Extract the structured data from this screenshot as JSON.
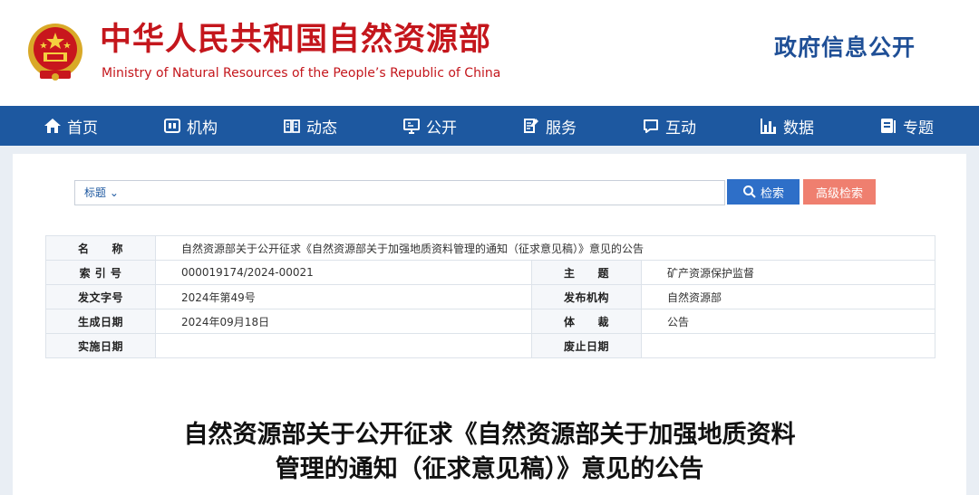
{
  "header": {
    "title": "中华人民共和国自然资源部",
    "subtitle": "Ministry of Natural Resources of the People’s Republic of China",
    "gov_info": "政府信息公开",
    "emblem_icon": "national-emblem-icon"
  },
  "nav": {
    "items": [
      {
        "label": "首页",
        "icon": "home-icon"
      },
      {
        "label": "机构",
        "icon": "org-icon"
      },
      {
        "label": "动态",
        "icon": "news-icon"
      },
      {
        "label": "公开",
        "icon": "monitor-icon"
      },
      {
        "label": "服务",
        "icon": "service-icon"
      },
      {
        "label": "互动",
        "icon": "chat-icon"
      },
      {
        "label": "数据",
        "icon": "bar-chart-icon"
      },
      {
        "label": "专题",
        "icon": "topic-icon"
      }
    ]
  },
  "search": {
    "field": "标题 ⌄",
    "value": "",
    "search_label": "检索",
    "advanced_label": "高级检索"
  },
  "meta": {
    "name_label": "名　　称",
    "name_value": "自然资源部关于公开征求《自然资源部关于加强地质资料管理的通知（征求意见稿）》意见的公告",
    "index_label": "索 引 号",
    "index_value": "000019174/2024-00021",
    "topic_label": "主　　题",
    "topic_value": "矿产资源保护监督",
    "docno_label": "发文字号",
    "docno_value": "2024年第49号",
    "issuer_label": "发布机构",
    "issuer_value": "自然资源部",
    "date_label": "生成日期",
    "date_value": "2024年09月18日",
    "genre_label": "体　　裁",
    "genre_value": "公告",
    "effective_label": "实施日期",
    "effective_value": "",
    "expiry_label": "废止日期",
    "expiry_value": ""
  },
  "document": {
    "title_line1": "自然资源部关于公开征求《自然资源部关于加强地质资料",
    "title_line2": "管理的通知（征求意见稿）》意见的公告"
  },
  "colors": {
    "brand_red": "#c4161c",
    "nav_blue": "#1d58a0",
    "search_blue": "#2e6fc8",
    "advanced_coral": "#ef7f6f"
  }
}
